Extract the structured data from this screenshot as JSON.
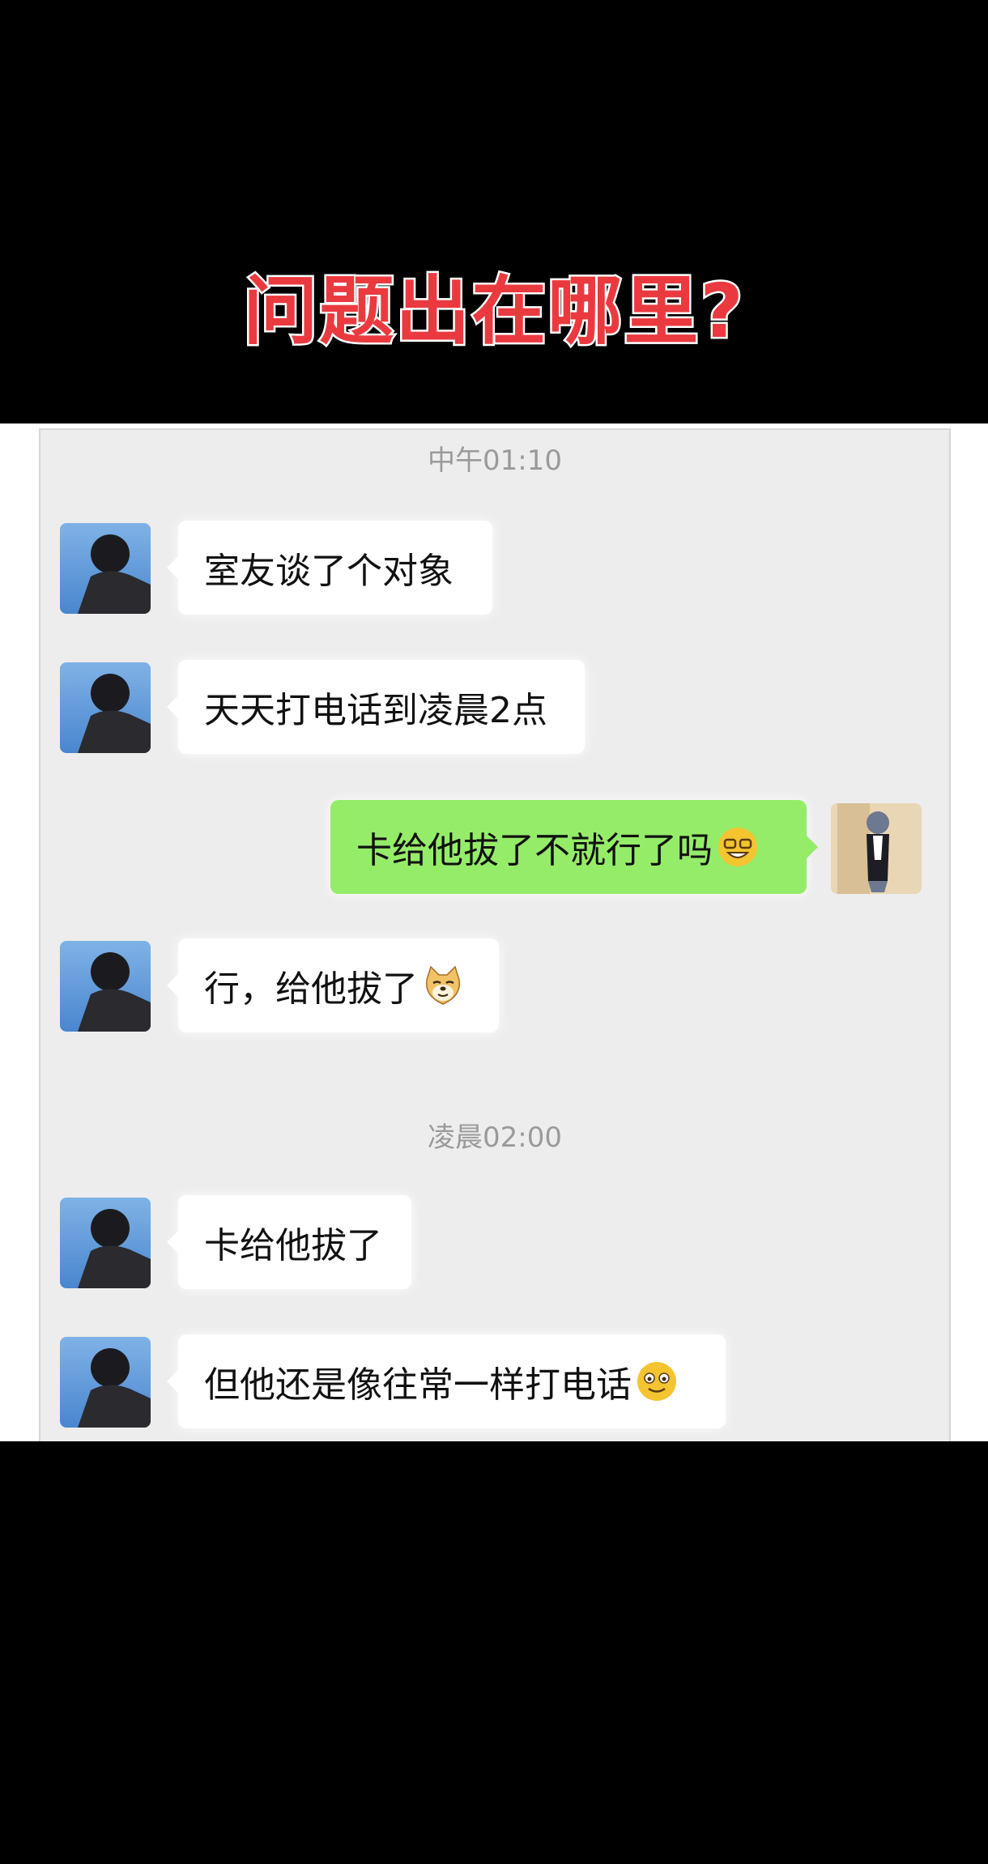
{
  "headline": "问题出在哪里?",
  "chat": {
    "time1": "中午01:10",
    "time2": "凌晨02:00",
    "messages": [
      {
        "side": "in",
        "text": "室友谈了个对象"
      },
      {
        "side": "in",
        "text": "天天打电话到凌晨2点"
      },
      {
        "side": "out",
        "text": "卡给他拔了不就行了吗",
        "emoji": "grin-with-glasses-emoji"
      },
      {
        "side": "in",
        "text": "行，给他拔了",
        "emoji": "doge-emoji"
      },
      {
        "side": "in",
        "text": "卡给他拔了"
      },
      {
        "side": "in",
        "text": "但他还是像往常一样打电话",
        "emoji": "smiling-emoji"
      }
    ]
  },
  "colors": {
    "headline": "#ea3a3f",
    "incoming_bubble": "#ffffff",
    "outgoing_bubble": "#95ec69",
    "chat_background": "#ededed",
    "timestamp": "#9a9a9a"
  }
}
